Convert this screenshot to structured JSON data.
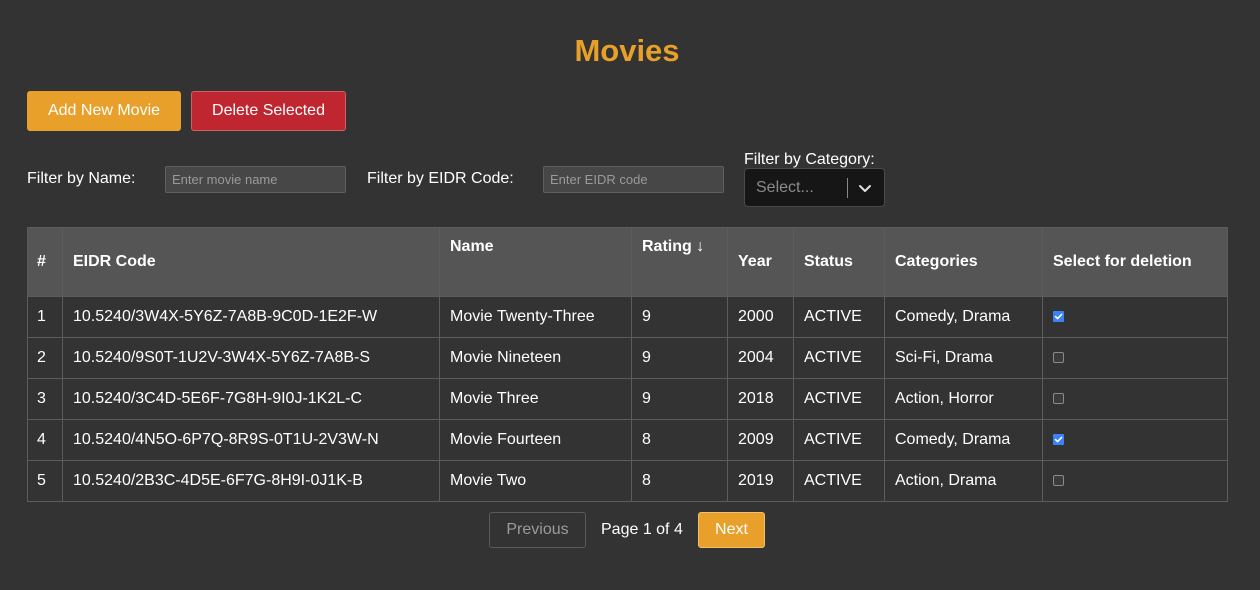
{
  "header": {
    "title": "Movies"
  },
  "actions": {
    "add_label": "Add New Movie",
    "delete_label": "Delete Selected"
  },
  "filters": {
    "name_label": "Filter by Name:",
    "name_placeholder": "Enter movie name",
    "name_value": "",
    "eidr_label": "Filter by EIDR Code:",
    "eidr_placeholder": "Enter EIDR code",
    "eidr_value": "",
    "category_label": "Filter by Category:",
    "category_placeholder": "Select..."
  },
  "table": {
    "columns": [
      "#",
      "EIDR Code",
      "Name",
      "Rating",
      "Year",
      "Status",
      "Categories",
      "Select for deletion"
    ],
    "sort": {
      "column": "Rating",
      "direction": "desc",
      "arrow": "↓"
    },
    "rows": [
      {
        "num": "1",
        "eidr": "10.5240/3W4X-5Y6Z-7A8B-9C0D-1E2F-W",
        "name": "Movie Twenty-Three",
        "rating": "9",
        "year": "2000",
        "status": "ACTIVE",
        "categories": "Comedy, Drama",
        "selected": true
      },
      {
        "num": "2",
        "eidr": "10.5240/9S0T-1U2V-3W4X-5Y6Z-7A8B-S",
        "name": "Movie Nineteen",
        "rating": "9",
        "year": "2004",
        "status": "ACTIVE",
        "categories": "Sci-Fi, Drama",
        "selected": false
      },
      {
        "num": "3",
        "eidr": "10.5240/3C4D-5E6F-7G8H-9I0J-1K2L-C",
        "name": "Movie Three",
        "rating": "9",
        "year": "2018",
        "status": "ACTIVE",
        "categories": "Action, Horror",
        "selected": false
      },
      {
        "num": "4",
        "eidr": "10.5240/4N5O-6P7Q-8R9S-0T1U-2V3W-N",
        "name": "Movie Fourteen",
        "rating": "8",
        "year": "2009",
        "status": "ACTIVE",
        "categories": "Comedy, Drama",
        "selected": true
      },
      {
        "num": "5",
        "eidr": "10.5240/2B3C-4D5E-6F7G-8H9I-0J1K-B",
        "name": "Movie Two",
        "rating": "8",
        "year": "2019",
        "status": "ACTIVE",
        "categories": "Action, Drama",
        "selected": false
      }
    ]
  },
  "pagination": {
    "previous_label": "Previous",
    "page_info": "Page 1 of 4",
    "next_label": "Next"
  },
  "colors": {
    "accent": "#e8a02a",
    "danger": "#c0262f",
    "background": "#333333",
    "table_header": "#555555"
  },
  "icons": {
    "category_dropdown": "chevron-down-icon",
    "checkbox_checked": "check-icon"
  }
}
